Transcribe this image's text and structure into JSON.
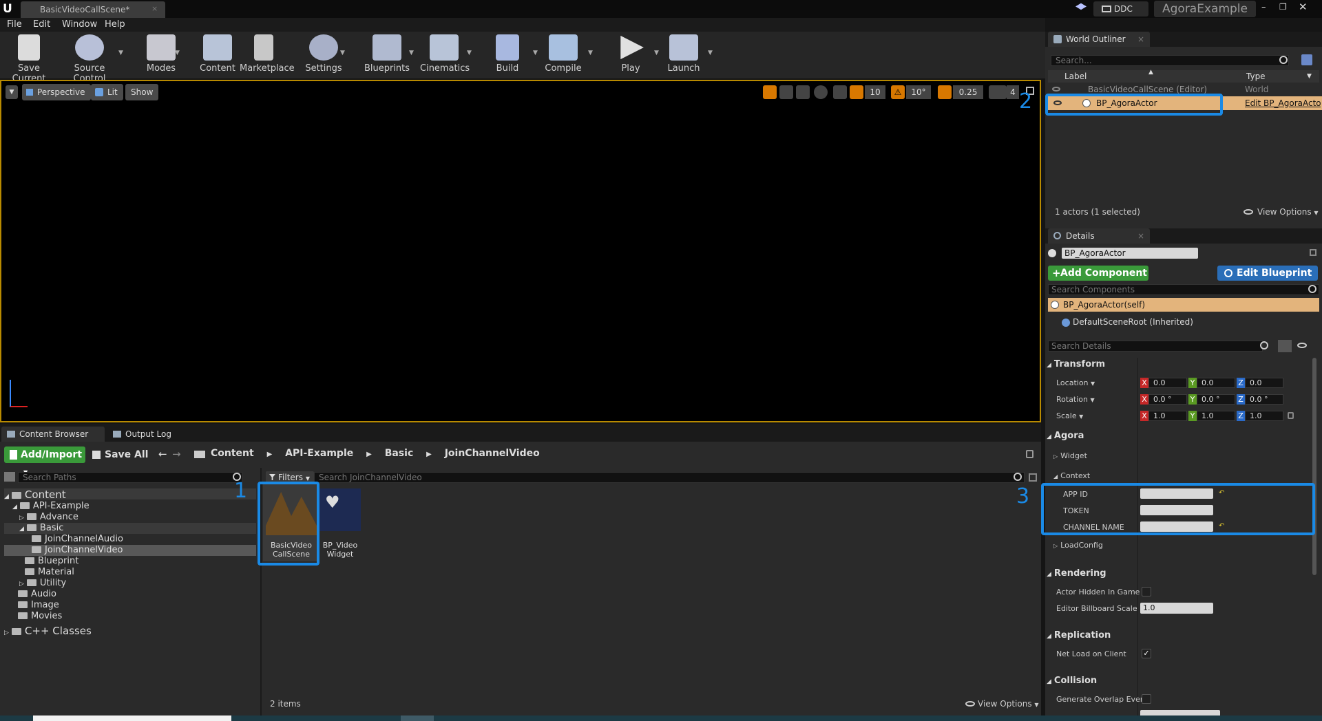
{
  "window": {
    "tab_title": "BasicVideoCallScene*",
    "ddc_label": "DDC",
    "project_name": "AgoraExample"
  },
  "menu": [
    "File",
    "Edit",
    "Window",
    "Help"
  ],
  "toolbar": [
    "Save Current",
    "Source Control",
    "Modes",
    "Content",
    "Marketplace",
    "Settings",
    "Blueprints",
    "Cinematics",
    "Build",
    "Compile",
    "Play",
    "Launch"
  ],
  "viewport": {
    "perspective_label": "Perspective",
    "lit_label": "Lit",
    "show_label": "Show",
    "grid_value": "10",
    "rotation_value": "10°",
    "scale_value": "0.25",
    "camera_speed": "4"
  },
  "content_browser": {
    "tab_label": "Content Browser",
    "output_log_label": "Output Log",
    "add_import_label": "Add/Import",
    "save_all_label": "Save All",
    "breadcrumb": [
      "Content",
      "API-Example",
      "Basic",
      "JoinChannelVideo"
    ],
    "search_paths_placeholder": "Search Paths",
    "filters_label": "Filters",
    "search_assets_placeholder": "Search JoinChannelVideo",
    "tree": [
      "Content",
      "API-Example",
      "Advance",
      "Basic",
      "JoinChannelAudio",
      "JoinChannelVideo",
      "Blueprint",
      "Material",
      "Utility",
      "Audio",
      "Image",
      "Movies",
      "C++ Classes"
    ],
    "assets": [
      {
        "line1": "BasicVideo",
        "line2": "CallScene"
      },
      {
        "line1": "BP_Video",
        "line2": "Widget"
      }
    ],
    "item_count": "2 items",
    "view_options": "View Options"
  },
  "outliner": {
    "title": "World Outliner",
    "search_placeholder": "Search...",
    "col_label": "Label",
    "col_type": "Type",
    "rows": [
      {
        "label": "BasicVideoCallScene (Editor)",
        "type": "World"
      },
      {
        "label": "BP_AgoraActor",
        "type": "Edit BP_AgoraActor"
      }
    ],
    "status": "1 actors (1 selected)",
    "view_options": "View Options"
  },
  "details": {
    "title": "Details",
    "actor_name": "BP_AgoraActor",
    "add_component": "Add Component",
    "edit_blueprint": "Edit Blueprint",
    "search_components_placeholder": "Search Components",
    "component_self": "BP_AgoraActor(self)",
    "component_root": "DefaultSceneRoot (Inherited)",
    "search_details_placeholder": "Search Details",
    "transform": {
      "section": "Transform",
      "location_label": "Location",
      "rotation_label": "Rotation",
      "scale_label": "Scale",
      "location": [
        "0.0",
        "0.0",
        "0.0"
      ],
      "rotation": [
        "0.0 °",
        "0.0 °",
        "0.0 °"
      ],
      "scale": [
        "1.0",
        "1.0",
        "1.0"
      ]
    },
    "agora": {
      "section": "Agora",
      "widget": "Widget",
      "context": "Context",
      "app_id": "APP ID",
      "token": "TOKEN",
      "channel_name": "CHANNEL NAME",
      "load_config": "LoadConfig"
    },
    "rendering": {
      "section": "Rendering",
      "hidden": "Actor Hidden In Game",
      "billboard": "Editor Billboard Scale",
      "billboard_value": "1.0"
    },
    "replication": {
      "section": "Replication",
      "net_load": "Net Load on Client"
    },
    "collision": {
      "section": "Collision",
      "overlap": "Generate Overlap Event"
    }
  },
  "annotations": [
    "1",
    "2",
    "3"
  ],
  "axis_letters": [
    "X",
    "Y",
    "Z"
  ],
  "colors": {
    "accent_blue": "#1a8ae6",
    "selection": "#e3b47c",
    "green_button": "#3a9a3a",
    "blue_button": "#2a6eb8"
  }
}
